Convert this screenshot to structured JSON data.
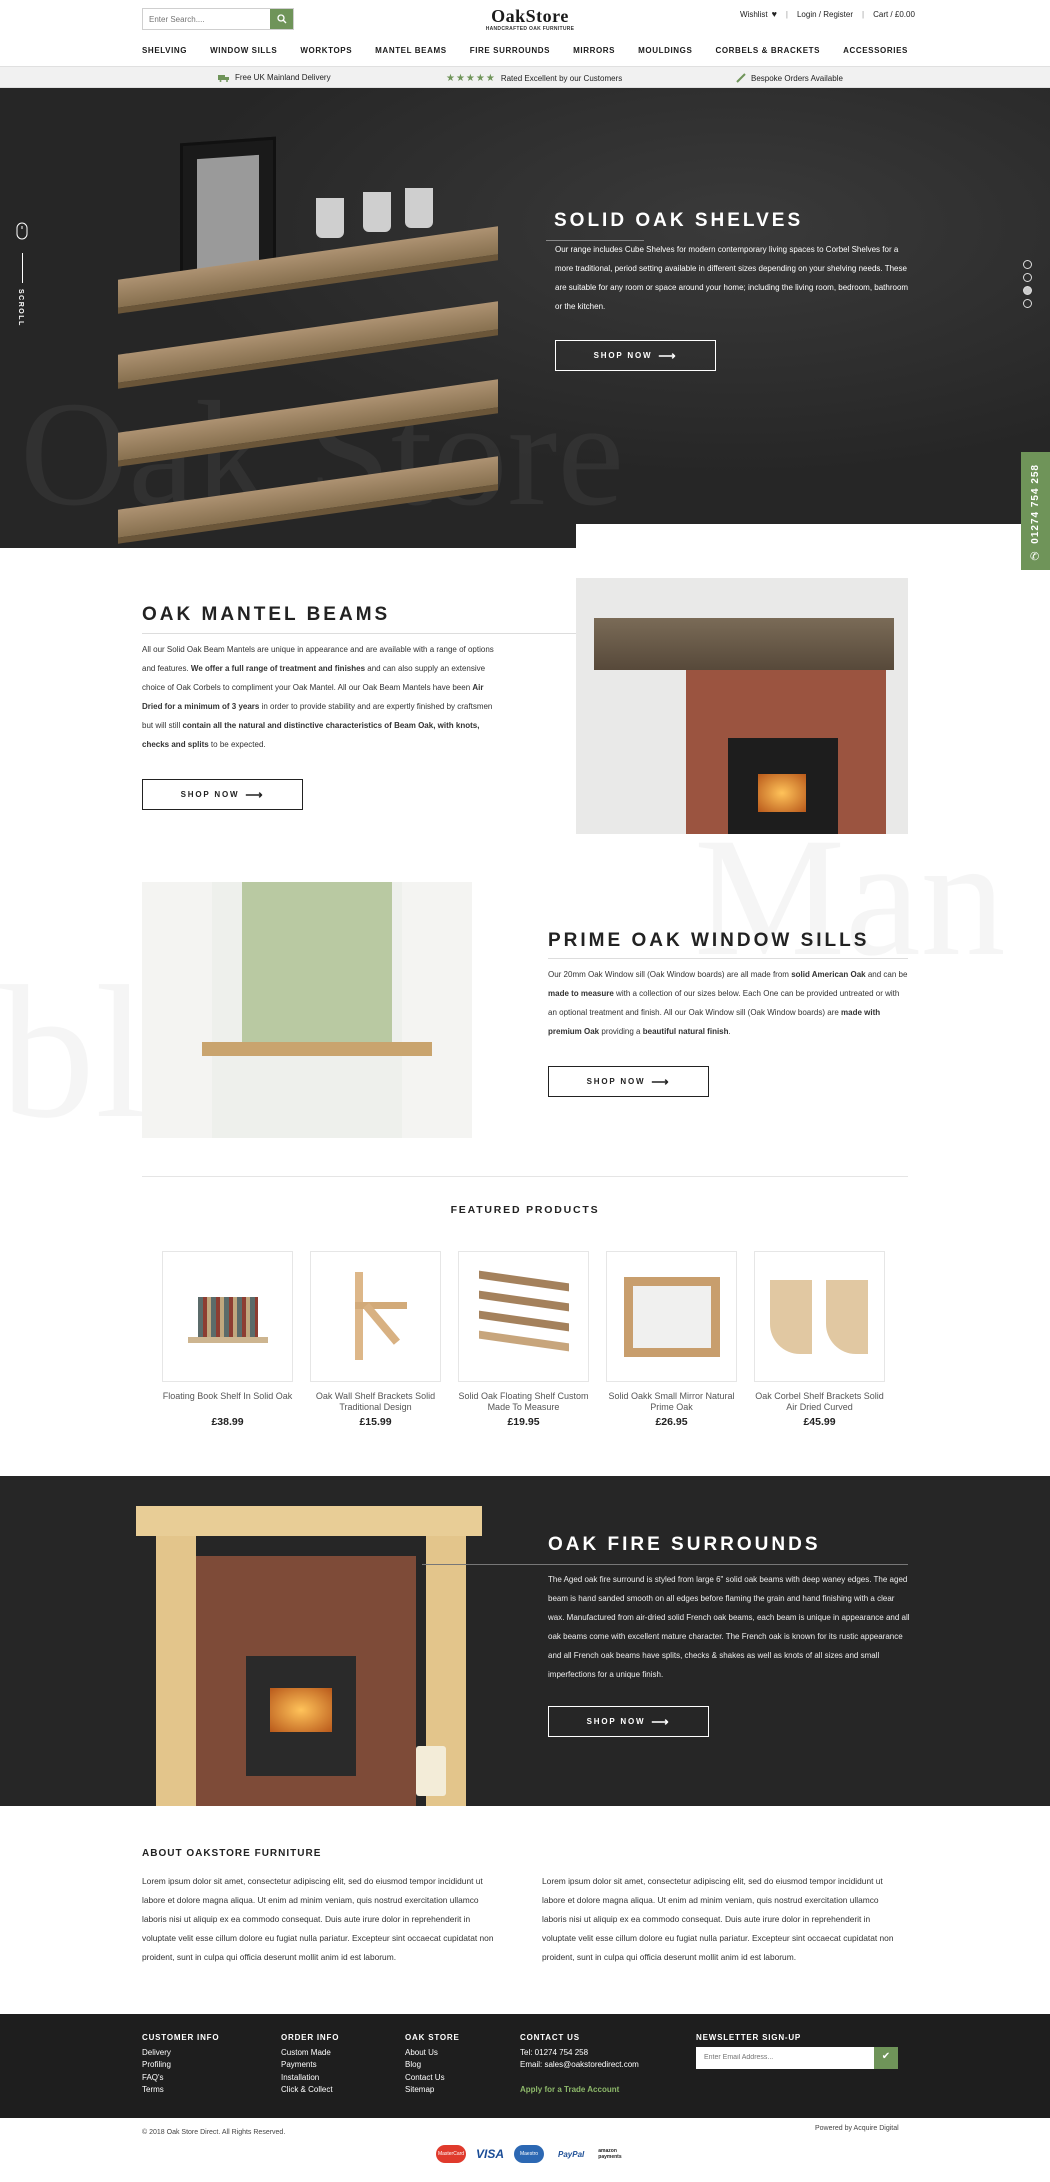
{
  "header": {
    "search_placeholder": "Enter Search....",
    "logo": "OakStore",
    "logo_tagline": "HANDCRAFTED OAK FURNITURE",
    "wishlist": "Wishlist",
    "login": "Login / Register",
    "cart": "Cart / £0.00"
  },
  "nav": [
    "SHELVING",
    "WINDOW SILLS",
    "WORKTOPS",
    "MANTEL BEAMS",
    "FIRE SURROUNDS",
    "MIRRORS",
    "MOULDINGS",
    "CORBELS & BRACKETS",
    "ACCESSORIES"
  ],
  "benefits": [
    "Free UK Mainland Delivery",
    "Rated Excellent by our Customers",
    "Bespoke Orders Available"
  ],
  "hero": {
    "title": "SOLID OAK SHELVES",
    "text": "Our range includes Cube Shelves for modern contemporary living spaces to Corbel Shelves for a more traditional, period setting available in different sizes depending on your shelving needs.  These are suitable for any room or space around your home; including the living room, bedroom, bathroom or the kitchen.",
    "button": "SHOP NOW",
    "scroll": "SCROLL",
    "slides": 4,
    "active_slide": 3,
    "watermark": "Oak Store"
  },
  "phone": "01274 754 258",
  "mantel": {
    "title": "OAK MANTEL BEAMS",
    "p1": "All our Solid Oak Beam Mantels are unique in appearance and are available with a range of options and features. ",
    "b1": "We offer a full range of treatment and finishes",
    "p2": " and can also supply an extensive choice of Oak Corbels to compliment your Oak Mantel. All our Oak Beam Mantels have been ",
    "b2": "Air Dried for a minimum of 3 years",
    "p3": " in order to provide stability and are expertly finished by craftsmen but will still ",
    "b3": "contain all the natural and distinctive characteristics of Beam Oak, with knots, checks and splits",
    "p4": " to be expected.",
    "button": "SHOP NOW",
    "watermark": "Man"
  },
  "sills": {
    "title": "PRIME OAK WINDOW SILLS",
    "p1": "Our 20mm Oak Window sill (Oak Window boards) are all made from ",
    "b1": "solid American Oak",
    "p2": " and can be ",
    "b2": "made to measure",
    "p3": " with a collection of our sizes below. Each One can be provided untreated or with an optional treatment and finish. All our Oak Window sill (Oak Window boards) are ",
    "b3": "made with premium Oak",
    "p4": " providing a ",
    "b4": "beautiful natural finish",
    "p5": ".",
    "button": "SHOP NOW",
    "watermark": "bles"
  },
  "featured": {
    "title": "FEATURED PRODUCTS",
    "products": [
      {
        "name": "Floating Book Shelf In Solid Oak",
        "price": "£38.99"
      },
      {
        "name": "Oak Wall Shelf Brackets Solid Traditional Design",
        "price": "£15.99"
      },
      {
        "name": "Solid Oak Floating Shelf Custom Made To Measure",
        "price": "£19.95"
      },
      {
        "name": "Solid Oakk Small Mirror Natural Prime Oak",
        "price": "£26.95"
      },
      {
        "name": "Oak Corbel Shelf Brackets Solid Air Dried Curved",
        "price": "£45.99"
      }
    ]
  },
  "fire": {
    "title": "OAK FIRE SURROUNDS",
    "text": "The Aged oak fire surround is styled from large 6\" solid oak beams with deep waney edges. The aged beam is hand sanded smooth on all edges before flaming the grain and hand finishing with a clear wax. Manufactured from air-dried solid French oak beams, each beam is unique in appearance and all oak beams come with excellent mature character. The French oak is known for its rustic appearance and all French oak beams have splits, checks & shakes as well as knots of all sizes and small imperfections for a unique finish.",
    "button": "SHOP NOW"
  },
  "about": {
    "title": "ABOUT OAKSTORE FURNITURE",
    "col1": "Lorem ipsum dolor sit amet, consectetur adipiscing elit, sed do eiusmod tempor incididunt ut labore et dolore magna aliqua. Ut enim ad minim veniam, quis nostrud exercitation ullamco laboris nisi ut aliquip ex ea commodo consequat. Duis aute irure dolor in reprehenderit in voluptate velit esse cillum dolore eu fugiat nulla pariatur. Excepteur sint occaecat cupidatat non proident, sunt in culpa qui officia deserunt mollit anim id est laborum.",
    "col2": "Lorem ipsum dolor sit amet, consectetur adipiscing elit, sed do eiusmod tempor incididunt ut labore et dolore magna aliqua. Ut enim ad minim veniam, quis nostrud exercitation ullamco laboris nisi ut aliquip ex ea commodo consequat. Duis aute irure dolor in reprehenderit in voluptate velit esse cillum dolore eu fugiat nulla pariatur. Excepteur sint occaecat cupidatat non proident, sunt in culpa qui officia deserunt mollit anim id est laborum."
  },
  "footer": {
    "customer": {
      "title": "CUSTOMER INFO",
      "links": [
        "Delivery",
        "Profiling",
        "FAQ's",
        "Terms"
      ]
    },
    "order": {
      "title": "ORDER INFO",
      "links": [
        "Custom Made",
        "Payments",
        "Installation",
        "Click & Collect"
      ]
    },
    "store": {
      "title": "OAK STORE",
      "links": [
        "About Us",
        "Blog",
        "Contact Us",
        "Sitemap"
      ]
    },
    "contact": {
      "title": "CONTACT US",
      "tel": "Tel: 01274 754 258",
      "email": "Email: sales@oakstoredirect.com",
      "trade": "Apply for a Trade Account"
    },
    "newsletter": {
      "title": "NEWSLETTER SIGN-UP",
      "placeholder": "Enter Email Address..."
    },
    "copyright": "© 2018 Oak Store Direct. All Rights Reserved.",
    "powered": "Powered by Acquire Digital",
    "payments": [
      "MasterCard",
      "VISA",
      "Maestro",
      "PayPal",
      "amazon payments"
    ]
  },
  "colors": {
    "accent": "#6f9459",
    "dark": "#262626"
  }
}
